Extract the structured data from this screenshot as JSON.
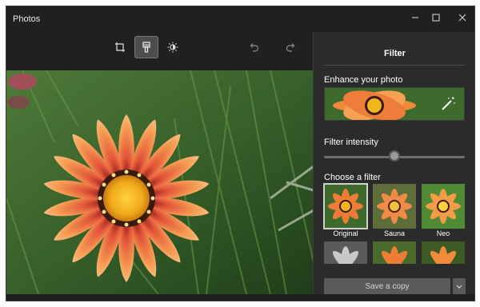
{
  "window": {
    "title": "Photos",
    "controls": {
      "minimize_icon": "minimize-icon",
      "maximize_icon": "maximize-icon",
      "close_icon": "close-icon"
    }
  },
  "toolbar": {
    "tools": [
      {
        "icon": "crop-icon",
        "active": false
      },
      {
        "icon": "filter-brush-icon",
        "active": true
      },
      {
        "icon": "brightness-icon",
        "active": false
      }
    ],
    "undo_icon": "undo-icon",
    "redo_icon": "redo-icon"
  },
  "panel": {
    "title": "Filter",
    "enhance_label": "Enhance your photo",
    "intensity_label": "Filter intensity",
    "intensity_value": 0.5,
    "choose_label": "Choose a filter",
    "filters": [
      {
        "label": "Original",
        "selected": true
      },
      {
        "label": "Sauna",
        "selected": false
      },
      {
        "label": "Neo",
        "selected": false
      },
      {
        "label": "",
        "selected": false
      },
      {
        "label": "",
        "selected": false
      },
      {
        "label": "",
        "selected": false
      }
    ],
    "save_label": "Save a copy"
  },
  "colors": {
    "background": "#202020",
    "panel": "#2b2b2b",
    "petal": "#f08a3a",
    "center": "#f2b51e"
  }
}
